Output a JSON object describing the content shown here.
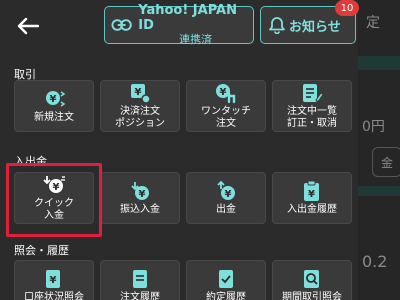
{
  "colors": {
    "accent": "#5cc7c5",
    "icon": "#7ee0dd",
    "badge": "#e03b3b",
    "highlight": "#e0203a"
  },
  "header": {
    "yahoo_line1": "Yahoo! JAPAN ID",
    "yahoo_line2": "連携済",
    "notice_label": "お知らせ",
    "badge_count": "10"
  },
  "sections": {
    "trade": {
      "title": "取引",
      "tiles": [
        {
          "label": "新規注文",
          "icon": "yen-cycle-icon"
        },
        {
          "label": "決済注文\nポジション",
          "icon": "yen-square-icon"
        },
        {
          "label": "ワンタッチ\n注文",
          "icon": "yen-touch-icon"
        },
        {
          "label": "注文中一覧\n訂正・取消",
          "icon": "list-edit-icon"
        }
      ]
    },
    "deposit": {
      "title": "入出金",
      "tiles": [
        {
          "label": "クイック\n入金",
          "icon": "yen-quick-deposit-icon"
        },
        {
          "label": "振込入金",
          "icon": "yen-down-icon"
        },
        {
          "label": "出金",
          "icon": "yen-up-icon"
        },
        {
          "label": "入出金履歴",
          "icon": "history-clipboard-icon"
        }
      ]
    },
    "inquiry": {
      "title": "照会・履歴",
      "tiles": [
        {
          "label": "口座状況照会",
          "icon": "yen-doc-icon"
        },
        {
          "label": "注文履歴",
          "icon": "doc-icon"
        },
        {
          "label": "約定履歴",
          "icon": "check-doc-icon"
        },
        {
          "label": "期間取引照会",
          "icon": "search-doc-icon"
        }
      ]
    }
  },
  "background": {
    "peek_top": "定",
    "peek_mid": "0円",
    "peek_circle": "金",
    "peek_bottom": "0.2"
  }
}
